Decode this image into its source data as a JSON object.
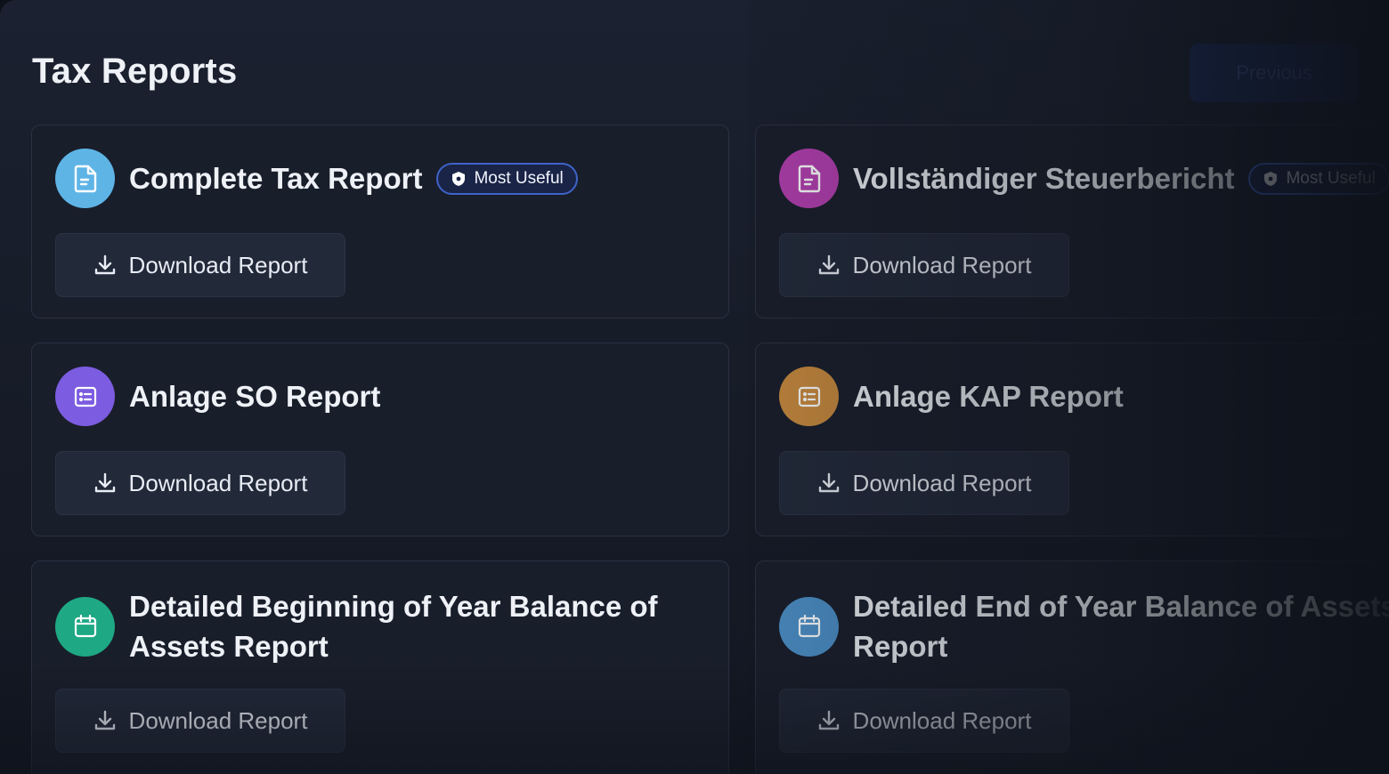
{
  "header": {
    "title": "Tax Reports",
    "previous_label": "Previous"
  },
  "reports": [
    {
      "title": "Complete Tax Report",
      "badge": "Most Useful",
      "icon": "document-icon",
      "icon_color": "#5fb4e6",
      "download_label": "Download Report"
    },
    {
      "title": "Vollständiger Steuerbericht",
      "badge": "Most Useful",
      "icon": "document-icon",
      "icon_color": "#b43fb0",
      "download_label": "Download Report"
    },
    {
      "title": "Anlage SO Report",
      "icon": "list-icon",
      "icon_color": "#7c5ce0",
      "download_label": "Download Report"
    },
    {
      "title": "Anlage KAP Report",
      "icon": "list-icon",
      "icon_color": "#c88a3e",
      "download_label": "Download Report"
    },
    {
      "title": "Detailed Beginning of Year Balance of Assets Report",
      "icon": "calendar-icon",
      "icon_color": "#1ea884",
      "download_label": "Download Report"
    },
    {
      "title": "Detailed End of Year Balance of Assets Report",
      "icon": "calendar-icon",
      "icon_color": "#4c90c8",
      "download_label": "Download Report"
    }
  ],
  "colors": {
    "background": "#0d1119",
    "card": "#191e2b",
    "badge_border": "#3e63c8",
    "button": "#222939"
  }
}
